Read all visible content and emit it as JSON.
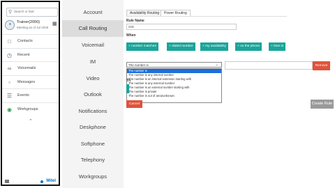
{
  "sidebar": {
    "search_placeholder": "Search or Dial",
    "user": {
      "name": "Trainer(2000)",
      "status": "Meeting as of Jul 2025"
    },
    "nav": [
      {
        "label": "Contacts",
        "icon": "contacts-icon"
      },
      {
        "label": "Recent",
        "icon": "recent-icon"
      },
      {
        "label": "Voicemails",
        "icon": "voicemail-icon"
      },
      {
        "label": "Messages",
        "icon": "messages-icon"
      },
      {
        "label": "Events",
        "icon": "events-icon"
      },
      {
        "label": "Workgroups",
        "icon": "workgroups-icon"
      }
    ],
    "brand": "Mitel"
  },
  "settings_menu": {
    "items": [
      "Account",
      "Call Routing",
      "Voicemail",
      "IM",
      "Video",
      "Outlook",
      "Notifications",
      "Deskphone",
      "Softphone",
      "Telephony",
      "Workgroups"
    ],
    "active": "Call Routing"
  },
  "main": {
    "tabs": [
      "Availability Routing",
      "Power Routing"
    ],
    "active_tab": "Power Routing",
    "rule_name_label": "Rule Name",
    "rule_name_value": "CID",
    "when_label": "When",
    "conditions": [
      "+ number matches",
      "+ dialed number",
      "+ my availability",
      "+ on the phone",
      "+ time is"
    ],
    "select_value": "The number is",
    "dropdown_options": [
      "The number is",
      "The number is any internal number",
      "The number is an internal extension starting with",
      "The number is any external number",
      "The number is an external number starting with",
      "The number is private",
      "The number is out of area/unknown"
    ],
    "remove_label": "Remove",
    "then_label": "Th",
    "cancel_label": "Cancel",
    "create_label": "Create Rule"
  },
  "colors": {
    "accent": "#1aa59a",
    "danger": "#e0533b",
    "selection": "#1e6fd9"
  }
}
